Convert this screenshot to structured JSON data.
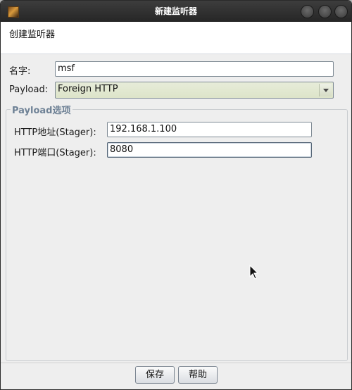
{
  "window": {
    "title": "新建监听器"
  },
  "header": {
    "text": "创建监听器"
  },
  "form": {
    "name_label": "名字:",
    "name_value": "msf",
    "payload_label": "Payload:",
    "payload_value": "Foreign HTTP"
  },
  "options": {
    "legend": "Payload选项",
    "host_label": "HTTP地址(Stager):",
    "host_value": "192.168.1.100",
    "port_label": "HTTP端口(Stager):",
    "port_value": "8080"
  },
  "footer": {
    "save_label": "保存",
    "help_label": "帮助"
  },
  "icons": {
    "app": "app-icon",
    "minimize": "minimize-icon",
    "maximize": "maximize-icon",
    "close": "close-icon",
    "dropdown": "chevron-down-icon",
    "cursor": "mouse-pointer-icon"
  }
}
